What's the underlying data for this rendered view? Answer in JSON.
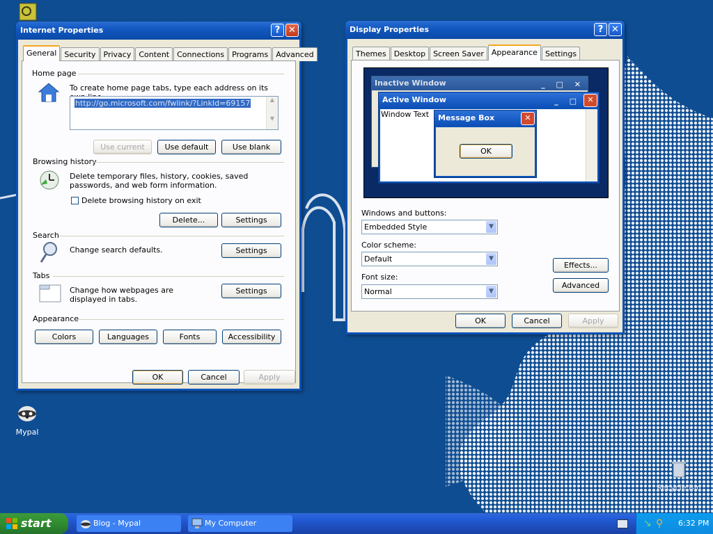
{
  "colors": {
    "desktop": "#0f4d92",
    "titlebar": "#0b52b8",
    "dialog_bg": "#ece9d8",
    "tab_accent": "#f5a623"
  },
  "desktop_icons": [
    {
      "name": "Mypal",
      "icon": "raccoon-icon"
    },
    {
      "name": "Recycle Bin",
      "icon": "recycle-bin-icon"
    }
  ],
  "internet_properties": {
    "title": "Internet Properties",
    "tabs": [
      "General",
      "Security",
      "Privacy",
      "Content",
      "Connections",
      "Programs",
      "Advanced"
    ],
    "active_tab": "General",
    "home_page": {
      "label": "Home page",
      "description": "To create home page tabs, type each address on its own line.",
      "url": "http://go.microsoft.com/fwlink/?LinkId=69157",
      "use_current": "Use current",
      "use_default": "Use default",
      "use_blank": "Use blank"
    },
    "browsing_history": {
      "label": "Browsing history",
      "description": "Delete temporary files, history, cookies, saved passwords, and web form information.",
      "checkbox_label": "Delete browsing history on exit",
      "delete_button": "Delete...",
      "settings_button": "Settings"
    },
    "search": {
      "label": "Search",
      "description": "Change search defaults.",
      "settings_button": "Settings"
    },
    "tabs_section": {
      "label": "Tabs",
      "description": "Change how webpages are displayed in tabs.",
      "settings_button": "Settings"
    },
    "appearance": {
      "label": "Appearance",
      "buttons": [
        "Colors",
        "Languages",
        "Fonts",
        "Accessibility"
      ]
    },
    "ok": "OK",
    "cancel": "Cancel",
    "apply": "Apply"
  },
  "display_properties": {
    "title": "Display Properties",
    "tabs": [
      "Themes",
      "Desktop",
      "Screen Saver",
      "Appearance",
      "Settings"
    ],
    "active_tab": "Appearance",
    "preview": {
      "inactive_window": "Inactive Window",
      "active_window": "Active Window",
      "window_text": "Window Text",
      "message_box": "Message Box",
      "ok": "OK"
    },
    "windows_and_buttons": {
      "label": "Windows and buttons:",
      "value": "Embedded Style"
    },
    "color_scheme": {
      "label": "Color scheme:",
      "value": "Default"
    },
    "font_size": {
      "label": "Font size:",
      "value": "Normal"
    },
    "effects": "Effects...",
    "advanced": "Advanced",
    "ok": "OK",
    "cancel": "Cancel",
    "apply": "Apply"
  },
  "taskbar": {
    "start": "start",
    "items": [
      "Blog - Mypal",
      "My Computer"
    ],
    "clock": "6:32 PM"
  }
}
